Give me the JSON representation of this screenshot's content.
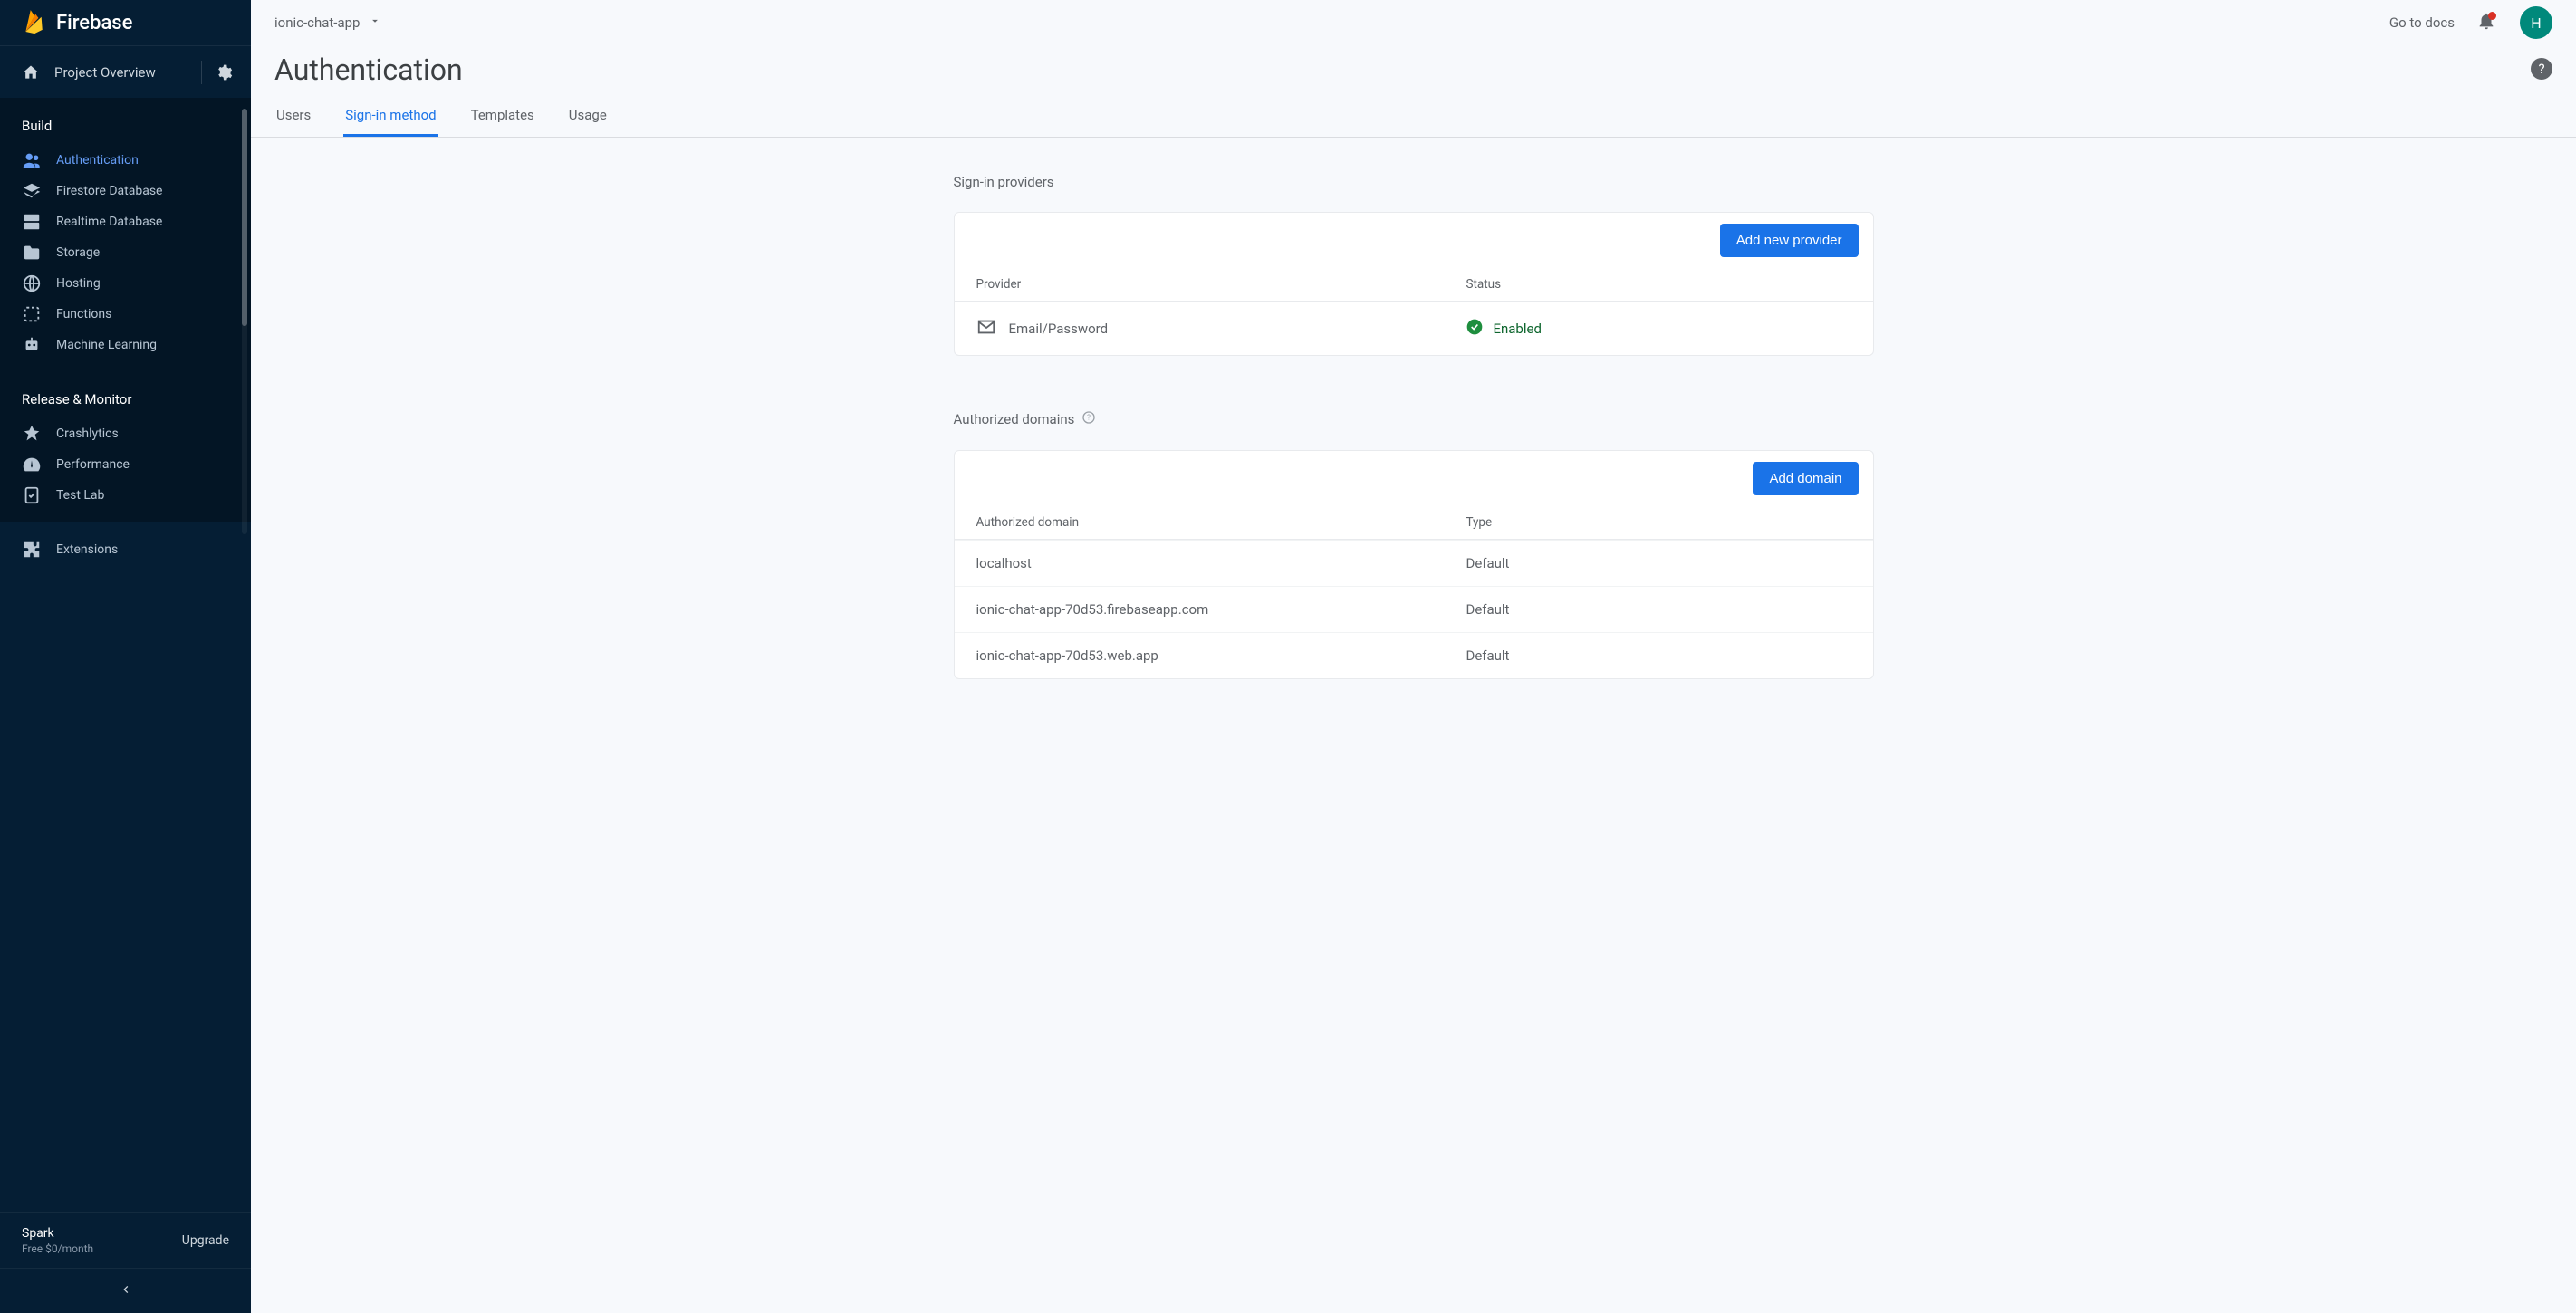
{
  "brand": "Firebase",
  "project_overview_label": "Project Overview",
  "sidebar": {
    "sections": {
      "build": {
        "title": "Build",
        "items": [
          {
            "id": "auth",
            "label": "Authentication",
            "active": true
          },
          {
            "id": "firestore",
            "label": "Firestore Database"
          },
          {
            "id": "rtdb",
            "label": "Realtime Database"
          },
          {
            "id": "storage",
            "label": "Storage"
          },
          {
            "id": "hosting",
            "label": "Hosting"
          },
          {
            "id": "functions",
            "label": "Functions"
          },
          {
            "id": "ml",
            "label": "Machine Learning"
          }
        ]
      },
      "release": {
        "title": "Release & Monitor",
        "items": [
          {
            "id": "crashlytics",
            "label": "Crashlytics"
          },
          {
            "id": "performance",
            "label": "Performance"
          },
          {
            "id": "testlab",
            "label": "Test Lab"
          }
        ]
      }
    },
    "extensions_label": "Extensions",
    "plan_name": "Spark",
    "plan_sub": "Free $0/month",
    "upgrade_label": "Upgrade"
  },
  "topbar": {
    "project_name": "ionic-chat-app",
    "docs_label": "Go to docs",
    "avatar_letter": "H"
  },
  "page": {
    "title": "Authentication",
    "tabs": [
      "Users",
      "Sign-in method",
      "Templates",
      "Usage"
    ],
    "active_tab": 1
  },
  "providers": {
    "section_title": "Sign-in providers",
    "add_button": "Add new provider",
    "columns": {
      "provider": "Provider",
      "status": "Status"
    },
    "rows": [
      {
        "name": "Email/Password",
        "status": "Enabled"
      }
    ]
  },
  "domains": {
    "section_title": "Authorized domains",
    "add_button": "Add domain",
    "columns": {
      "domain": "Authorized domain",
      "type": "Type"
    },
    "rows": [
      {
        "domain": "localhost",
        "type": "Default"
      },
      {
        "domain": "ionic-chat-app-70d53.firebaseapp.com",
        "type": "Default"
      },
      {
        "domain": "ionic-chat-app-70d53.web.app",
        "type": "Default"
      }
    ]
  }
}
